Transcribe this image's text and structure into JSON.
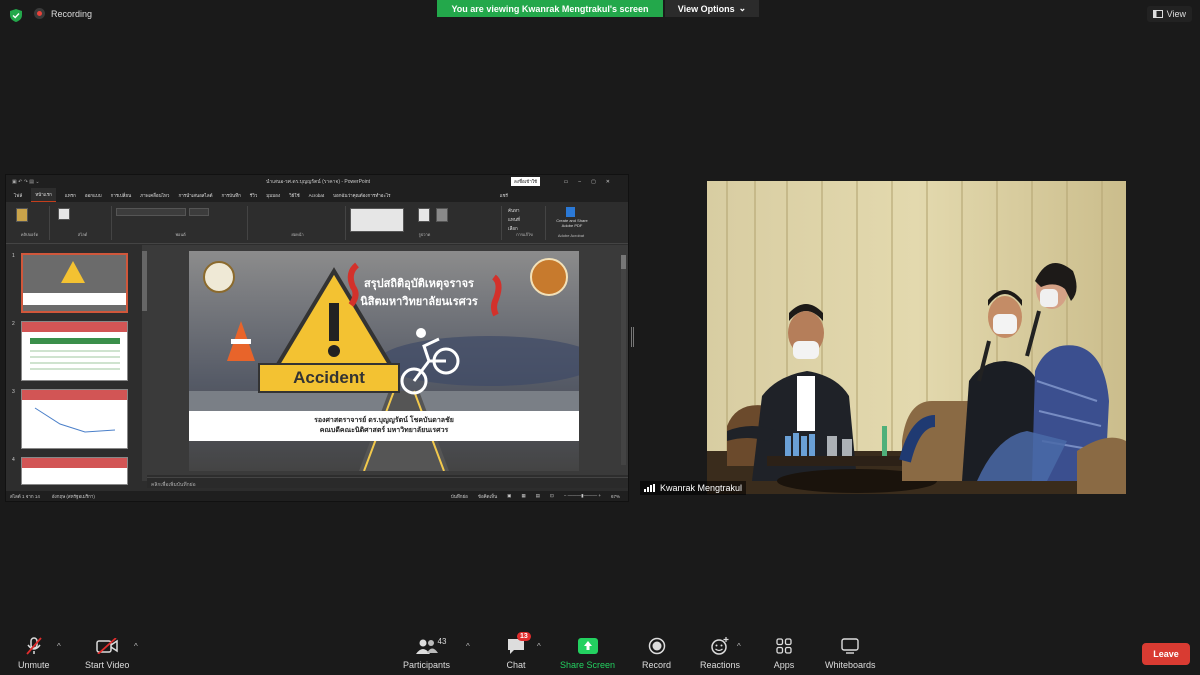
{
  "top": {
    "recording_label": "Recording",
    "banner": "You are viewing Kwanrak Mengtrakul's screen",
    "view_options": "View Options",
    "view_label": "View"
  },
  "ppt": {
    "title": "นำเสนอ-รศ.ดร.บุญญรัตน์ (ราคาจ) - PowerPoint",
    "signin": "ลงชื่อเข้าใช้",
    "tabs": [
      "ไฟล์",
      "หน้าแรก",
      "แทรก",
      "ออกแบบ",
      "การเปลี่ยน",
      "ภาพเคลื่อนไหว",
      "การนำเสนอสไลด์",
      "การบันทึก",
      "รีวิว",
      "มุมมอง",
      "วิธีใช้",
      "Acrobat",
      "บอกฉันว่าคุณต้องการทำอะไร"
    ],
    "share_label": "แชร์",
    "ribbon": {
      "clipboard": "คลิปบอร์ด",
      "slides": "สไลด์",
      "font": "ฟอนต์",
      "paragraph": "ย่อหน้า",
      "drawing": "รูปวาด",
      "editing": "การแก้ไข",
      "adobe_acrobat": "Adobe Acrobat",
      "create_share": "Create and Share Adobe PDF",
      "find": "ค้นหา",
      "replace": "แทนที่",
      "select": "เลือก"
    },
    "thumb_numbers": [
      "1",
      "2",
      "3",
      "4"
    ],
    "slide": {
      "title_line1": "สรุปสถิติอุบัติเหตุจราจร",
      "title_line2": "นิสิตมหาวิทยาลัยนเรศวร",
      "sign_text": "Accident",
      "presenter_line1": "รองศาสตราจารย์ ดร.บุญญรัตน์ โชคบันดาลชัย",
      "presenter_line2": "คณบดีคณะนิติศาสตร์ มหาวิทยาลัยนเรศวร"
    },
    "notes_placeholder": "คลิกเพื่อเพิ่มบันทึกย่อ",
    "status_left": "สไลด์ 1 จาก 14",
    "status_lang": "อังกฤษ (สหรัฐอเมริกา)",
    "status_notes": "บันทึกย่อ",
    "status_comments": "ข้อคิดเห็น",
    "status_zoom": "67%"
  },
  "camera": {
    "participant_name": "Kwanrak Mengtrakul"
  },
  "toolbar": {
    "unmute": "Unmute",
    "start_video": "Start Video",
    "participants": "Participants",
    "participants_count": "43",
    "chat": "Chat",
    "chat_badge": "13",
    "share_screen": "Share Screen",
    "record": "Record",
    "reactions": "Reactions",
    "apps": "Apps",
    "whiteboards": "Whiteboards",
    "leave": "Leave"
  },
  "colors": {
    "banner_green": "#23a84b",
    "leave_red": "#d93b32",
    "share_green": "#23d160"
  }
}
